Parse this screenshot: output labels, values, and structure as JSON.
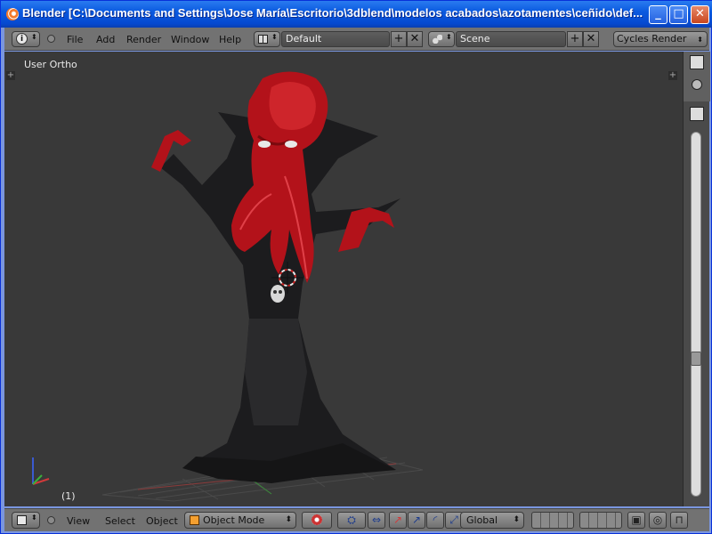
{
  "window": {
    "title": "Blender [C:\\Documents and Settings\\Jose María\\Escritorio\\3dblend\\modelos acabados\\azotamentes\\ceñido\\def..."
  },
  "header": {
    "menus": [
      "File",
      "Add",
      "Render",
      "Window",
      "Help"
    ],
    "layout": "Default",
    "scene": "Scene",
    "render_engine": "Cycles Render"
  },
  "viewport": {
    "view_label": "User Ortho",
    "frame": "(1)"
  },
  "footer": {
    "menus": [
      "View",
      "Select",
      "Object"
    ],
    "mode": "Object Mode",
    "orientation": "Global"
  },
  "colors": {
    "accent_orange": "#f5792a",
    "xp_title_blue": "#0a5ae0",
    "blender_header": "#727272",
    "viewport_bg": "#393939",
    "model_red": "#c0141a"
  }
}
